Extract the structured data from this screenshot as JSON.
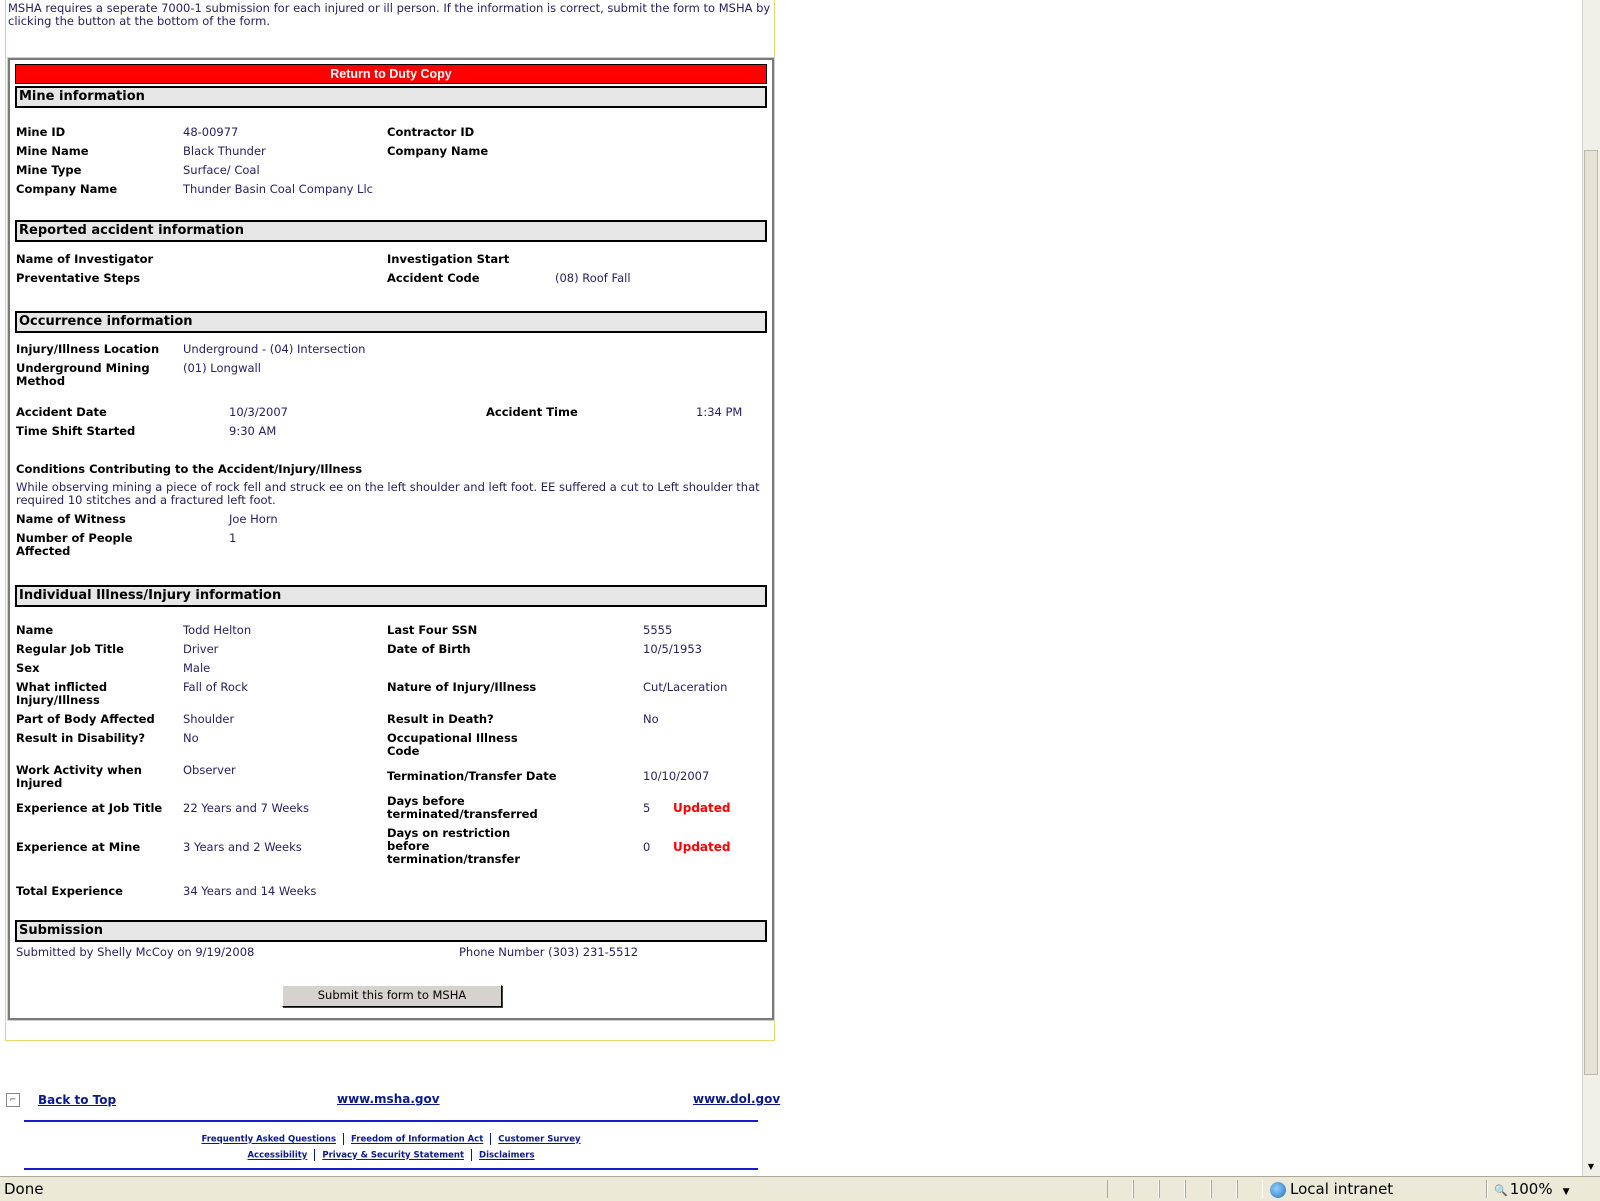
{
  "intro": "MSHA requires a seperate 7000-1 submission for each injured or ill person.  If the information is correct, submit the form to MSHA by clicking the button at the bottom of the form.",
  "copy_header": "Return to Duty Copy",
  "mine": {
    "heading": "Mine information",
    "mine_id_label": "Mine ID",
    "mine_id": "48-00977",
    "mine_name_label": "Mine Name",
    "mine_name": "Black Thunder",
    "mine_type_label": "Mine Type",
    "mine_type": "Surface/ Coal",
    "company_name_label": "Company Name",
    "company_name": "Thunder Basin Coal Company Llc",
    "contractor_id_label": "Contractor ID",
    "contractor_id": "",
    "contractor_company_label": "Company Name",
    "contractor_company": ""
  },
  "accident": {
    "heading": "Reported accident information",
    "investigator_label": "Name of Investigator",
    "investigator": "",
    "preventative_label": "Preventative Steps",
    "preventative": "",
    "inv_start_label": "Investigation Start",
    "inv_start": "",
    "accident_code_label": "Accident Code",
    "accident_code": "(08) Roof Fall"
  },
  "occurrence": {
    "heading": "Occurrence information",
    "location_label": "Injury/Illness Location",
    "location": "Underground - (04) Intersection",
    "method_label": "Underground Mining Method",
    "method": "(01) Longwall",
    "date_label": "Accident Date",
    "date": "10/3/2007",
    "time_label": "Accident Time",
    "time": "1:34 PM",
    "shift_label": "Time Shift Started",
    "shift": "9:30 AM",
    "conditions_label": "Conditions Contributing to the Accident/Injury/Illness",
    "conditions": "While observing mining a piece of rock fell and struck ee on the left shoulder and left foot. EE suffered a cut to Left shoulder that required 10 stitches and a fractured left foot.",
    "witness_label": "Name of Witness",
    "witness": "Joe Horn",
    "people_label": "Number of People Affected",
    "people": "1"
  },
  "individual": {
    "heading": "Individual Illness/Injury information",
    "name_label": "Name",
    "name": "Todd Helton",
    "job_label": "Regular Job Title",
    "job": "Driver",
    "sex_label": "Sex",
    "sex": "Male",
    "inflicted_label": "What inflicted Injury/Illness",
    "inflicted": "Fall of Rock",
    "body_label": "Part of Body Affected",
    "body": "Shoulder",
    "disability_label": "Result in Disability?",
    "disability": "No",
    "activity_label": "Work Activity when Injured",
    "activity": "Observer",
    "exp_job_label": "Experience at Job Title",
    "exp_job": "22 Years and 7 Weeks",
    "exp_mine_label": "Experience at Mine",
    "exp_mine": "3 Years and 2 Weeks",
    "exp_total_label": "Total Experience",
    "exp_total": "34 Years and 14 Weeks",
    "ssn_label": "Last Four SSN",
    "ssn": "5555",
    "dob_label": "Date of Birth",
    "dob": "10/5/1953",
    "nature_label": "Nature of Injury/Illness",
    "nature": "Cut/Laceration",
    "death_label": "Result in Death?",
    "death": "No",
    "occ_code_label": "Occupational Illness Code",
    "occ_code": "",
    "term_date_label": "Termination/Transfer Date",
    "term_date": "10/10/2007",
    "days_before_label": "Days before terminated/transferred",
    "days_before": "5",
    "days_restriction_label": "Days on restriction before termination/transfer",
    "days_restriction": "0",
    "updated": "Updated"
  },
  "submission": {
    "heading": "Submission",
    "submitted_by": "Submitted by  Shelly McCoy on 9/19/2008",
    "phone": "Phone Number  (303) 231-5512",
    "button": "Submit this form to MSHA"
  },
  "footer": {
    "back_to_top": "Back to Top",
    "msha": "www.msha.gov",
    "dol": "www.dol.gov",
    "faq": "Frequently Asked Questions",
    "foia": "Freedom of Information Act",
    "survey": "Customer Survey",
    "accessibility": "Accessibility",
    "privacy": "Privacy & Security Statement",
    "disclaimers": "Disclaimers"
  },
  "status": {
    "text": "Done",
    "zone": "Local intranet",
    "zoom": "100%"
  }
}
